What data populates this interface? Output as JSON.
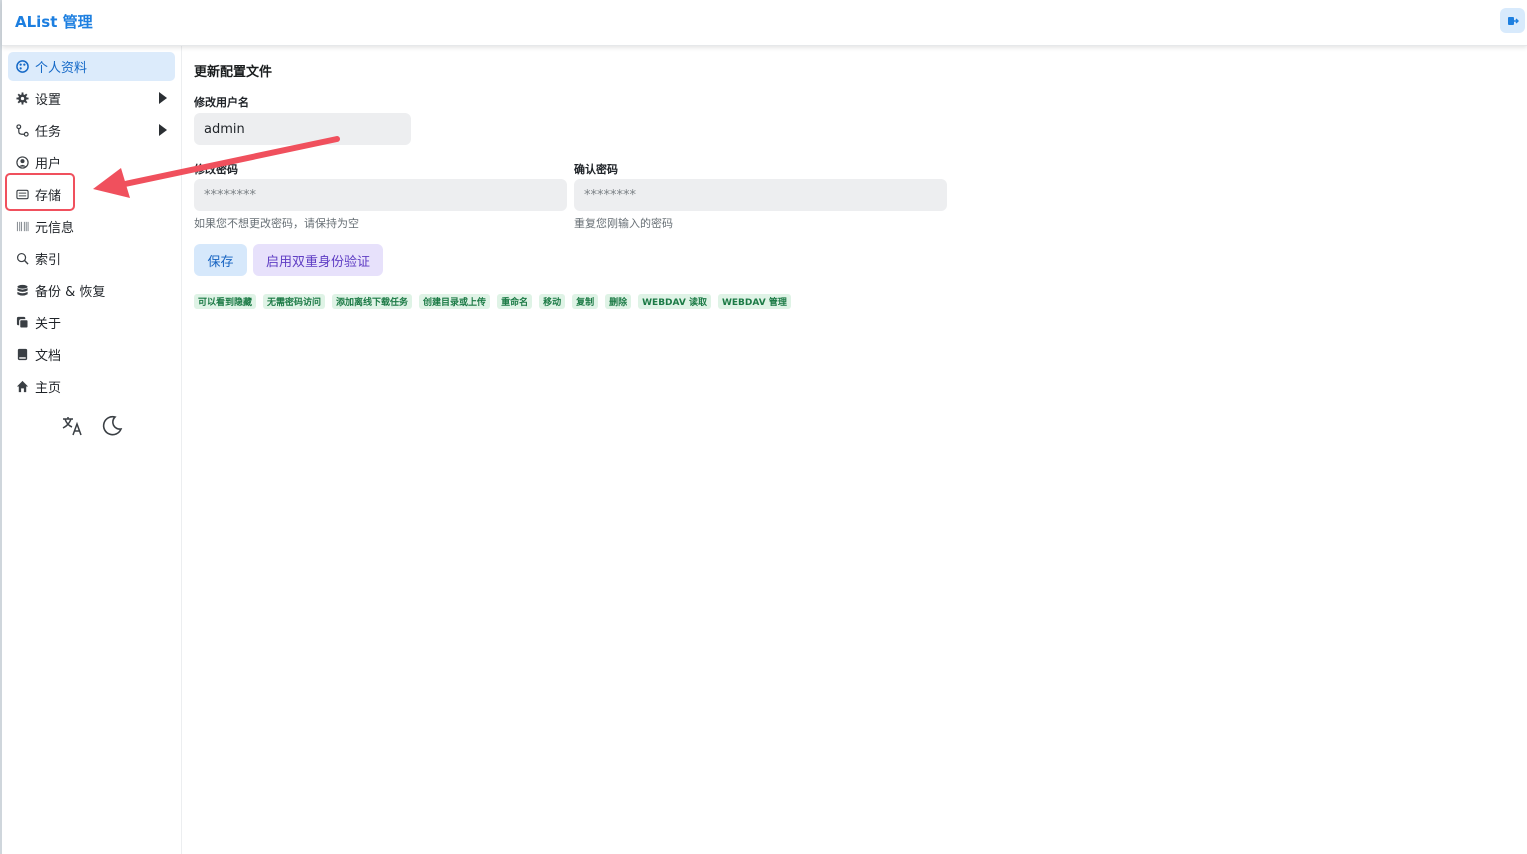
{
  "app": {
    "title": "AList 管理"
  },
  "sidebar": {
    "items": [
      {
        "label": "个人资料",
        "icon": "palette-icon",
        "active": true,
        "submenu": false
      },
      {
        "label": "设置",
        "icon": "gear-icon",
        "active": false,
        "submenu": true
      },
      {
        "label": "任务",
        "icon": "route-icon",
        "active": false,
        "submenu": true
      },
      {
        "label": "用户",
        "icon": "user-circle-icon",
        "active": false,
        "submenu": false
      },
      {
        "label": "存储",
        "icon": "storage-icon",
        "active": false,
        "submenu": false
      },
      {
        "label": "元信息",
        "icon": "barcode-icon",
        "active": false,
        "submenu": false
      },
      {
        "label": "索引",
        "icon": "search-icon",
        "active": false,
        "submenu": false
      },
      {
        "label": "备份 & 恢复",
        "icon": "database-icon",
        "active": false,
        "submenu": false
      },
      {
        "label": "关于",
        "icon": "copy-icon",
        "active": false,
        "submenu": false
      },
      {
        "label": "文档",
        "icon": "book-icon",
        "active": false,
        "submenu": false
      },
      {
        "label": "主页",
        "icon": "home-icon",
        "active": false,
        "submenu": false
      }
    ],
    "bottom_icons": [
      "translate-icon",
      "moon-icon"
    ]
  },
  "main": {
    "title": "更新配置文件",
    "username_label": "修改用户名",
    "username_value": "admin",
    "password_label": "修改密码",
    "password_placeholder": "********",
    "password_hint": "如果您不想更改密码，请保持为空",
    "confirm_label": "确认密码",
    "confirm_placeholder": "********",
    "confirm_hint": "重复您刚输入的密码",
    "save_button": "保存",
    "twofa_button": "启用双重身份验证",
    "permissions": [
      "可以看到隐藏",
      "无需密码访问",
      "添加离线下载任务",
      "创建目录或上传",
      "重命名",
      "移动",
      "复制",
      "删除",
      "WEBDAV 读取",
      "WEBDAV 管理"
    ]
  },
  "colors": {
    "accent": "#1d7fe0",
    "annotation": "#f0505d",
    "tag_bg": "#dff3e6",
    "tag_text": "#1b7a45"
  }
}
